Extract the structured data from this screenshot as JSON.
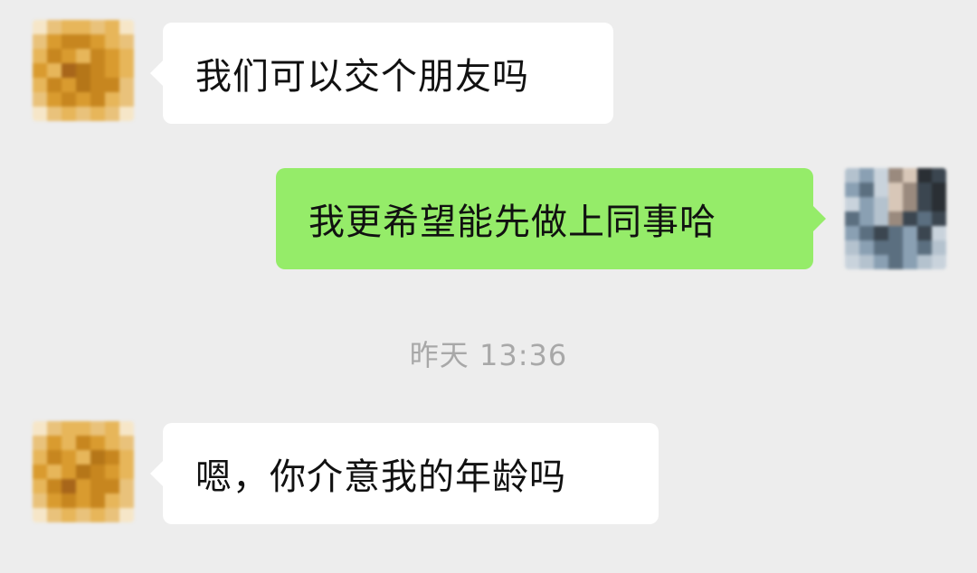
{
  "messages": [
    {
      "side": "left",
      "text": "我们可以交个朋友吗"
    },
    {
      "side": "right",
      "text": "我更希望能先做上同事哈"
    },
    {
      "side": "left",
      "text": "嗯，你介意我的年龄吗"
    }
  ],
  "timestamp": "昨天 13:36",
  "colors": {
    "background": "#ededed",
    "incoming_bubble": "#ffffff",
    "outgoing_bubble": "#95ec69",
    "timestamp_text": "#a8a8a8"
  }
}
